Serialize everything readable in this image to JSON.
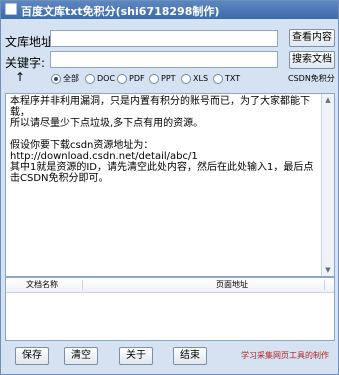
{
  "window": {
    "title": "百度文库txt免积分(shi6718298制作)"
  },
  "form": {
    "url_label": "文库地址:",
    "keyword_label": "关键字:",
    "url_value": "",
    "keyword_value": "",
    "view_button": "查看内容",
    "search_button": "搜索文档",
    "up_arrow": "↑",
    "csdn_label": "CSDN免积分"
  },
  "filters": [
    {
      "label": "全部",
      "checked": true
    },
    {
      "label": "DOC",
      "checked": false
    },
    {
      "label": "PDF",
      "checked": false
    },
    {
      "label": "PPT",
      "checked": false
    },
    {
      "label": "XLS",
      "checked": false
    },
    {
      "label": "TXT",
      "checked": false
    }
  ],
  "memo": {
    "text": "本程序并非利用漏洞，只是内置有积分的账号而已，为了大家都能下载，\n所以请尽量少下点垃圾,多下点有用的资源。\n\n假设你要下载csdn资源地址为：  http://download.csdn.net/detail/abc/1\n其中1就是资源的ID，请先清空此处内容，然后在此处输入1，最后点击CSDN免积分即可。"
  },
  "list": {
    "columns": [
      "文档名称",
      "页面地址"
    ]
  },
  "buttons": {
    "save": "保存",
    "clear": "清空",
    "about": "关于",
    "exit": "结束"
  },
  "footer": {
    "credit": "学习采集网页工具的制作"
  },
  "colors": {
    "credit_text": "#b21f1f",
    "titlebar": "#4673b3",
    "window_bg": "#d5e2f1"
  }
}
